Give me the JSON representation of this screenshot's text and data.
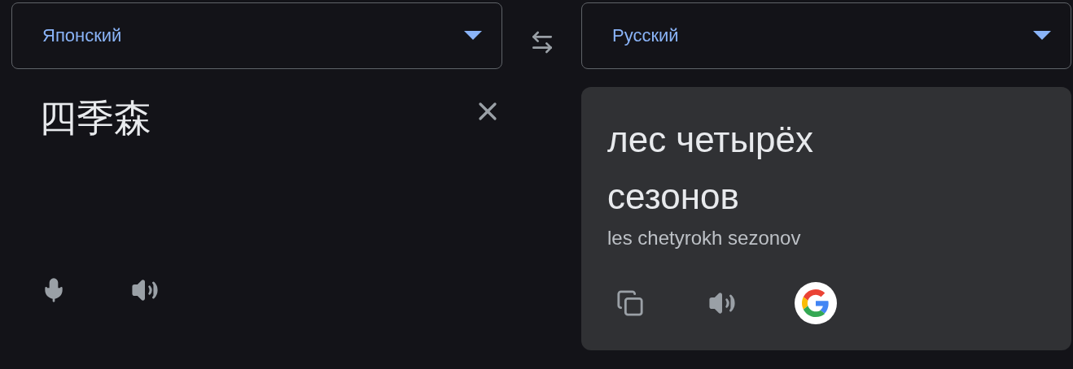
{
  "source_language": {
    "label": "Японский"
  },
  "target_language": {
    "label": "Русский"
  },
  "source_text": "四季森",
  "translation": "лес четырёх сезонов",
  "transliteration": "les chetyrokh sezonov"
}
